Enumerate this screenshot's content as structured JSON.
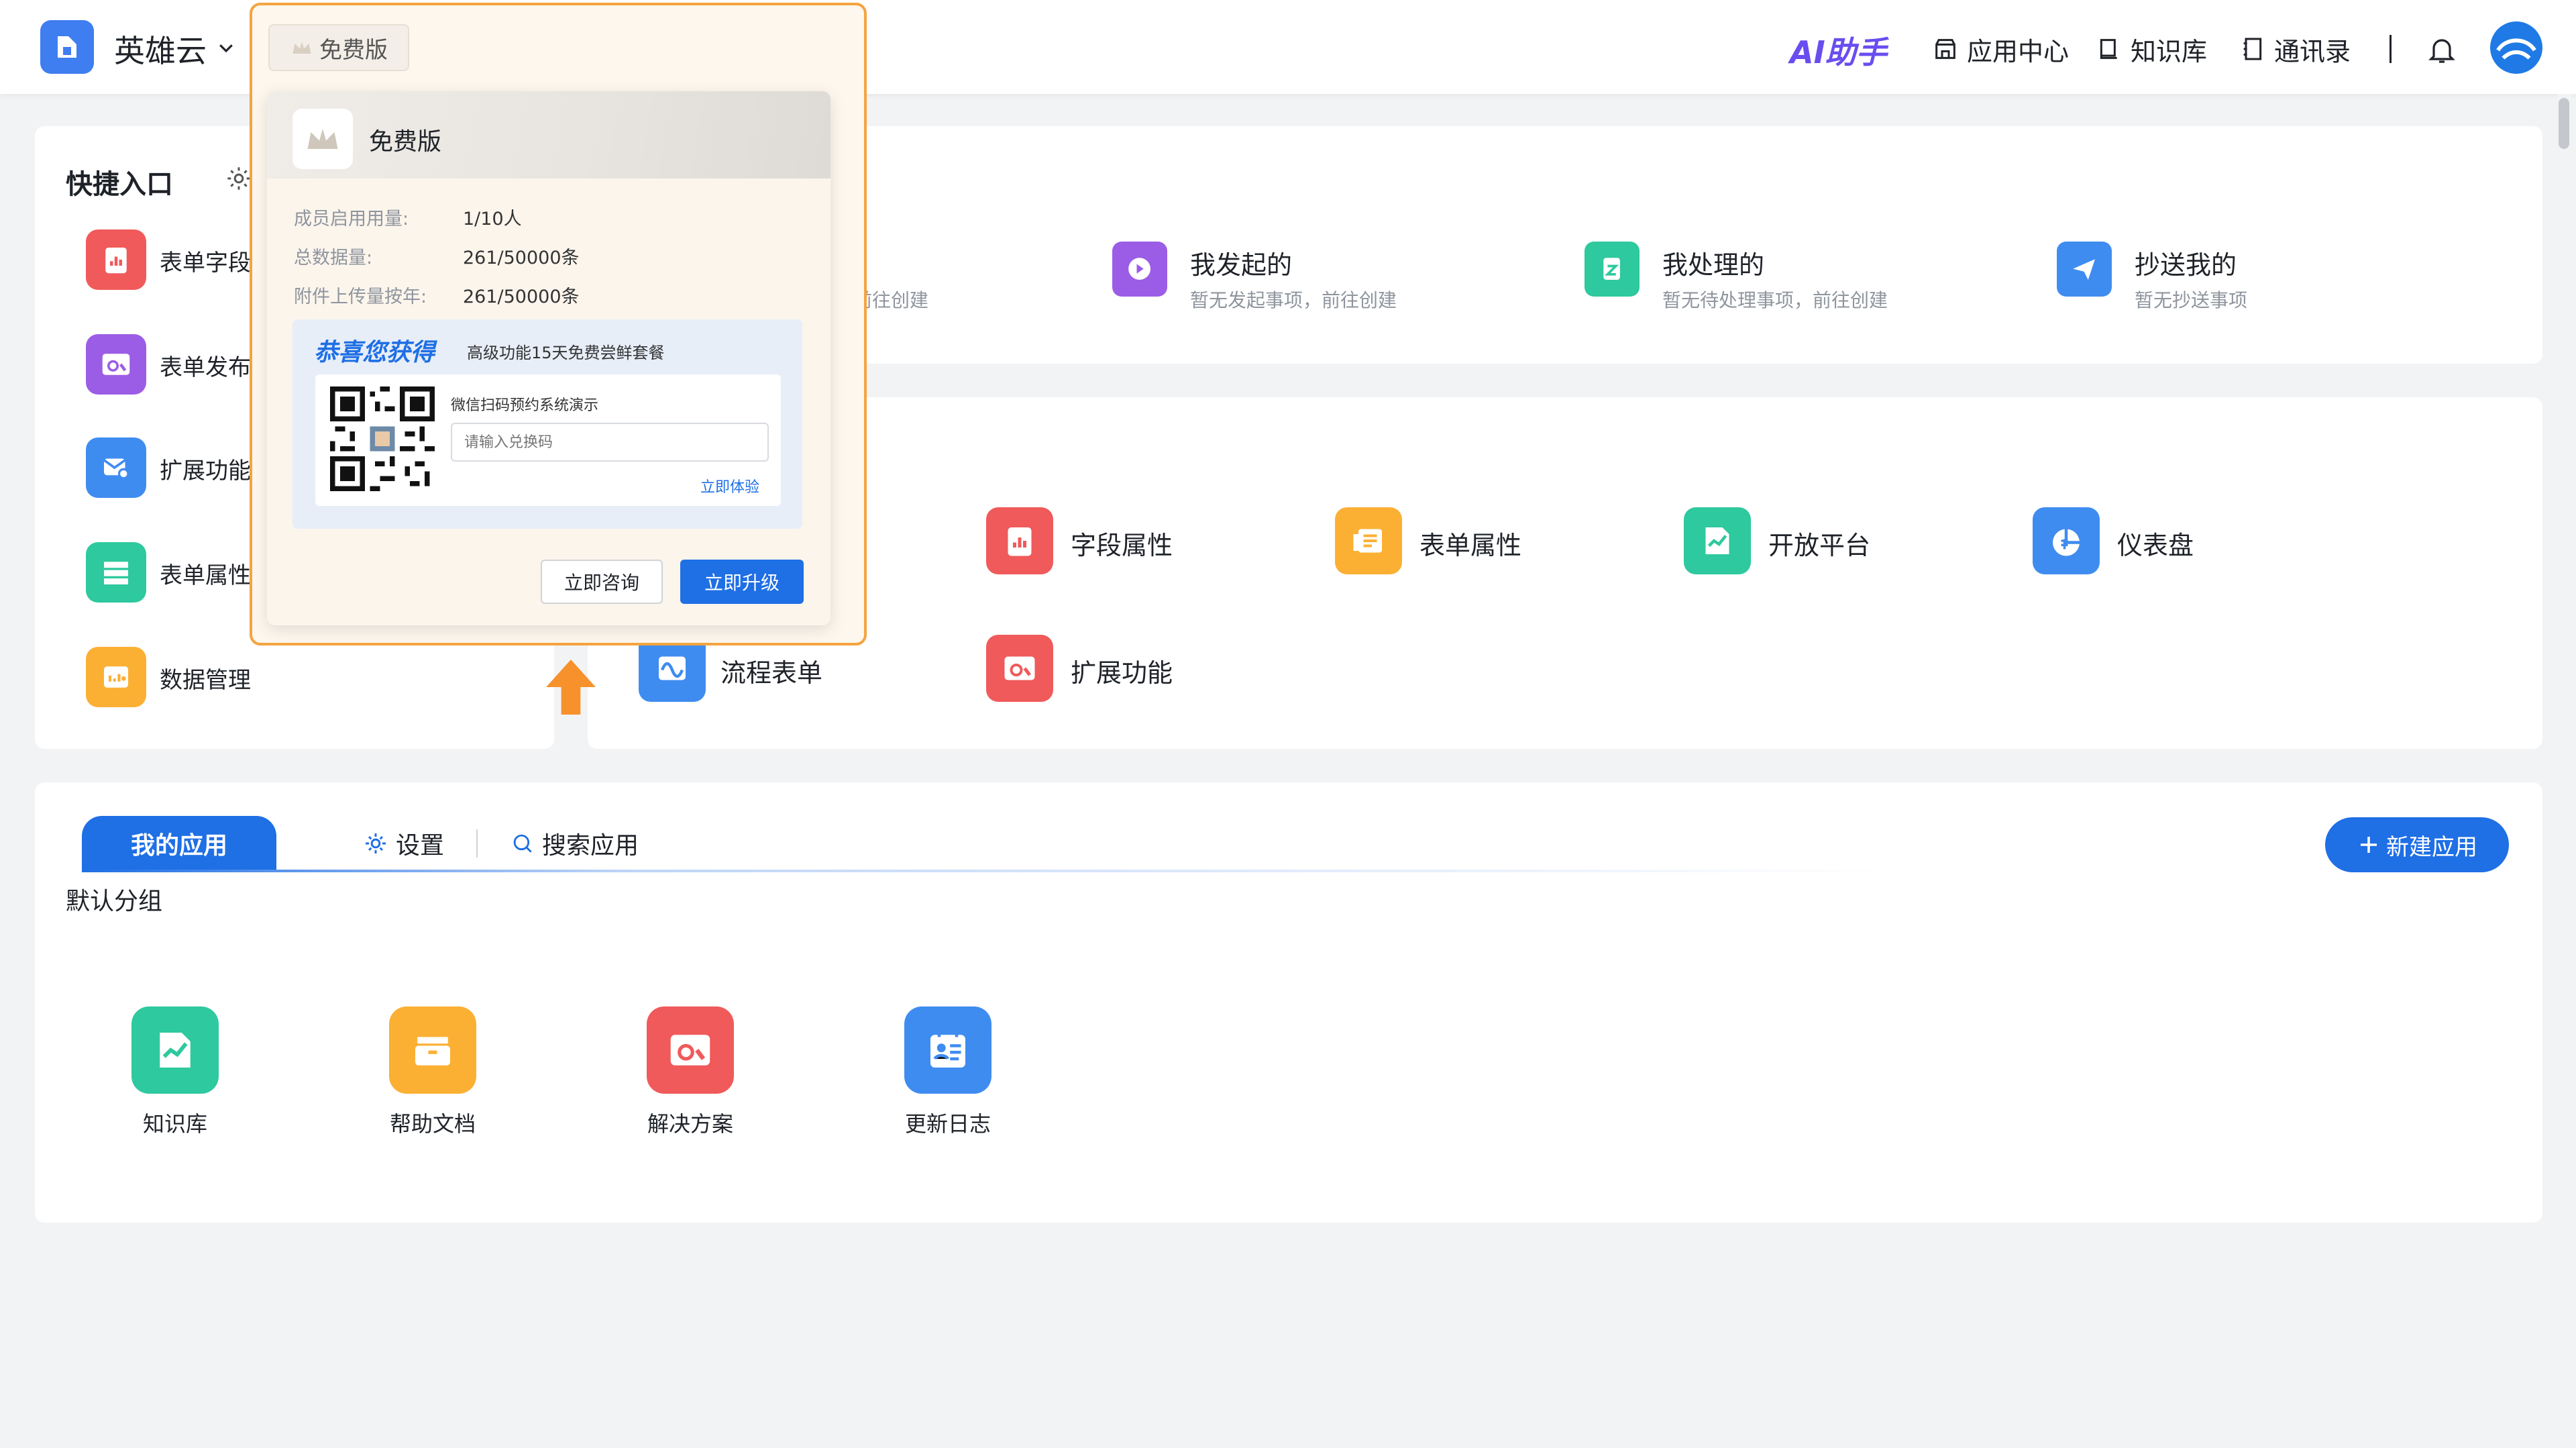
{
  "topbar": {
    "company": "英雄云",
    "edition_badge": "免费版",
    "ai_label": "AI助手",
    "nav": [
      "应用中心",
      "知识库",
      "通讯录"
    ]
  },
  "popup": {
    "title": "免费版",
    "rows": [
      {
        "label": "成员启用用量:",
        "value": "1/10人"
      },
      {
        "label": "总数据量:",
        "value": "261/50000条"
      },
      {
        "label": "附件上传量按年:",
        "value": "261/50000条"
      }
    ],
    "promo_title": "恭喜您获得",
    "promo_sub": "高级功能15天免费尝鲜套餐",
    "qr_caption": "微信扫码预约系统演示",
    "redeem_placeholder": "请输入兑换码",
    "try_link": "立即体验",
    "consult_button": "立即咨询",
    "upgrade_button": "立即升级"
  },
  "quick": {
    "title": "快捷入口",
    "items": [
      "表单字段",
      "表单发布",
      "扩展功能",
      "表单属性",
      "数据管理"
    ]
  },
  "tasks": [
    {
      "title": "",
      "sub": "项，前往创建"
    },
    {
      "title": "我发起的",
      "sub": "暂无发起事项，前往创建"
    },
    {
      "title": "我处理的",
      "sub": "暂无待处理事项，前往创建"
    },
    {
      "title": "抄送我的",
      "sub": "暂无抄送事项"
    }
  ],
  "features": [
    "字段属性",
    "表单属性",
    "开放平台",
    "仪表盘",
    "流程表单",
    "扩展功能"
  ],
  "apps_section": {
    "tab_active": "我的应用",
    "settings": "设置",
    "search": "搜索应用",
    "new_button": "新建应用",
    "group": "默认分组",
    "apps": [
      "知识库",
      "帮助文档",
      "解决方案",
      "更新日志"
    ]
  },
  "colors": {
    "primary": "#1f6fe5",
    "popup_border": "#f5a440",
    "red": "#f05a5a",
    "purple": "#9b5de5",
    "blue": "#3f8cf0",
    "green": "#2ec99e",
    "orange": "#fbb034"
  }
}
